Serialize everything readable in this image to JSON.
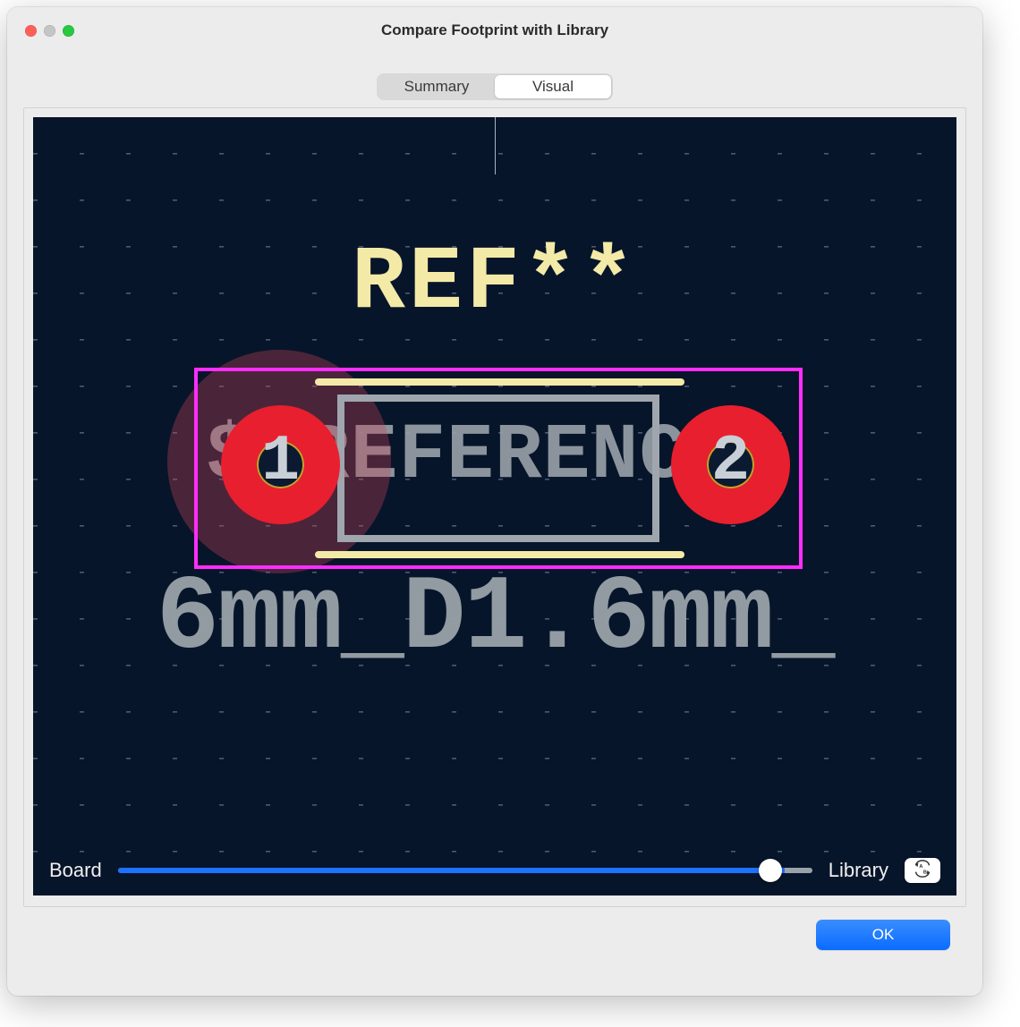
{
  "window": {
    "title": "Compare Footprint with Library"
  },
  "tabs": {
    "summary": "Summary",
    "visual": "Visual",
    "active": "visual"
  },
  "footprint": {
    "ref_text": "REF**",
    "reference_placeholder": "${REFERENCE}",
    "footprint_name_fragment": "6mm_D1.6mm_",
    "pad1_number": "1",
    "pad2_number": "2"
  },
  "footer": {
    "left_label": "Board",
    "right_label": "Library",
    "slider_percent": 96
  },
  "buttons": {
    "ok": "OK"
  },
  "icons": {
    "swap": "swap-ab-icon"
  },
  "colors": {
    "canvas_bg": "#07152a",
    "silk_yellow": "#f3eaa7",
    "courtyard_magenta": "#ff2dff",
    "fab_gray": "#9aa2a9",
    "copper_red": "#e81f2e",
    "accent_blue": "#1d72ff"
  }
}
